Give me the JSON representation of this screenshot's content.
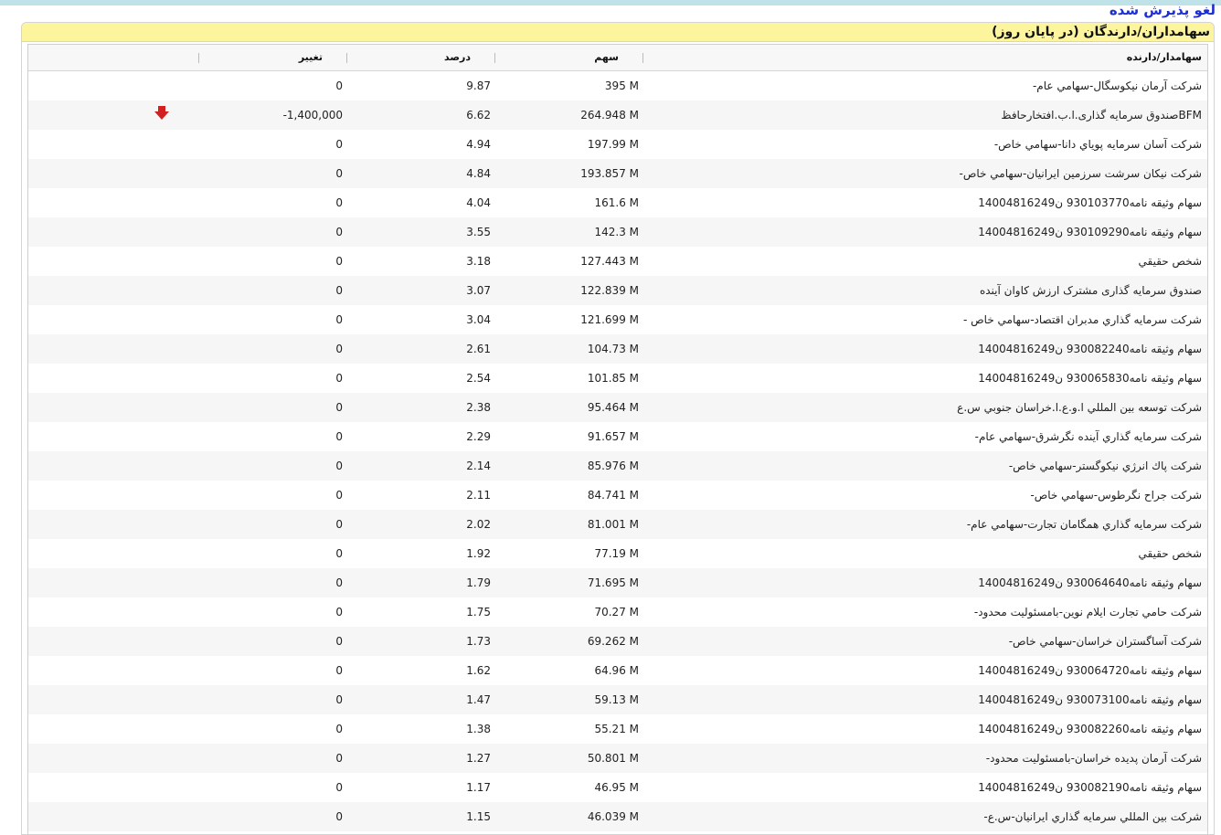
{
  "top_link": "لغو پذیرش شده",
  "panel_title": "سهامداران/دارندگان (در پایان روز)",
  "colors": {
    "title_bg": "#fdf59d",
    "link": "#1d2fd3",
    "down_arrow": "#d21f1f"
  },
  "columns": {
    "holder": "سهامدار/دارنده",
    "shares": "سهم",
    "percent": "درصد",
    "change": "تغییر"
  },
  "rows": [
    {
      "holder": "شرکت آرمان نیکوسگال-سهامي عام-",
      "shares": "395 M",
      "percent": "9.87",
      "change": "0",
      "indicator": ""
    },
    {
      "holder": "BFMصندوق سرمایه گذاری.ا.ب.افتخارحافظ",
      "shares": "264.948 M",
      "percent": "6.62",
      "change": "-1,400,000",
      "indicator": "down-arrow-icon"
    },
    {
      "holder": "شرکت آسان سرمایه پویاي دانا-سهامي خاص-",
      "shares": "197.99 M",
      "percent": "4.94",
      "change": "0",
      "indicator": ""
    },
    {
      "holder": "شرکت نیکان سرشت سرزمین ایرانیان-سهامي خاص-",
      "shares": "193.857 M",
      "percent": "4.84",
      "change": "0",
      "indicator": ""
    },
    {
      "holder": "سهام وثیقه نامه930103770 ن14004816249",
      "shares": "161.6 M",
      "percent": "4.04",
      "change": "0",
      "indicator": ""
    },
    {
      "holder": "سهام وثیقه نامه930109290 ن14004816249",
      "shares": "142.3 M",
      "percent": "3.55",
      "change": "0",
      "indicator": ""
    },
    {
      "holder": "شخص حقیقي",
      "shares": "127.443 M",
      "percent": "3.18",
      "change": "0",
      "indicator": ""
    },
    {
      "holder": "صندوق سرمایه گذاری مشترک ارزش کاوان آینده",
      "shares": "122.839 M",
      "percent": "3.07",
      "change": "0",
      "indicator": ""
    },
    {
      "holder": "شرکت سرمایه گذاري مدبران اقتصاد-سهامي خاص -",
      "shares": "121.699 M",
      "percent": "3.04",
      "change": "0",
      "indicator": ""
    },
    {
      "holder": "سهام وثیقه نامه930082240 ن14004816249",
      "shares": "104.73 M",
      "percent": "2.61",
      "change": "0",
      "indicator": ""
    },
    {
      "holder": "سهام وثیقه نامه930065830 ن14004816249",
      "shares": "101.85 M",
      "percent": "2.54",
      "change": "0",
      "indicator": ""
    },
    {
      "holder": "شرکت توسعه بین المللي ا.و.ع.ا.خراسان جنوبي س.ع",
      "shares": "95.464 M",
      "percent": "2.38",
      "change": "0",
      "indicator": ""
    },
    {
      "holder": "شرکت سرمایه گذاري آینده نگرشرق-سهامي عام-",
      "shares": "91.657 M",
      "percent": "2.29",
      "change": "0",
      "indicator": ""
    },
    {
      "holder": "شرکت پاك انرژي نیکوگستر-سهامي خاص-",
      "shares": "85.976 M",
      "percent": "2.14",
      "change": "0",
      "indicator": ""
    },
    {
      "holder": "شرکت جراح نگرطوس-سهامي خاص-",
      "shares": "84.741 M",
      "percent": "2.11",
      "change": "0",
      "indicator": ""
    },
    {
      "holder": "شرکت سرمایه گذاري همگامان تجارت-سهامي عام-",
      "shares": "81.001 M",
      "percent": "2.02",
      "change": "0",
      "indicator": ""
    },
    {
      "holder": "شخص حقیقي",
      "shares": "77.19 M",
      "percent": "1.92",
      "change": "0",
      "indicator": ""
    },
    {
      "holder": "سهام وثیقه نامه930064640 ن14004816249",
      "shares": "71.695 M",
      "percent": "1.79",
      "change": "0",
      "indicator": ""
    },
    {
      "holder": "شرکت حامي تجارت ایلام نوین-بامسئولیت محدود-",
      "shares": "70.27 M",
      "percent": "1.75",
      "change": "0",
      "indicator": ""
    },
    {
      "holder": "شرکت آساگستران خراسان-سهامي خاص-",
      "shares": "69.262 M",
      "percent": "1.73",
      "change": "0",
      "indicator": ""
    },
    {
      "holder": "سهام وثیقه نامه930064720 ن14004816249",
      "shares": "64.96 M",
      "percent": "1.62",
      "change": "0",
      "indicator": ""
    },
    {
      "holder": "سهام وثیقه نامه930073100 ن14004816249",
      "shares": "59.13 M",
      "percent": "1.47",
      "change": "0",
      "indicator": ""
    },
    {
      "holder": "سهام وثیقه نامه930082260 ن14004816249",
      "shares": "55.21 M",
      "percent": "1.38",
      "change": "0",
      "indicator": ""
    },
    {
      "holder": "شرکت آرمان پدیده خراسان-بامسئولیت محدود-",
      "shares": "50.801 M",
      "percent": "1.27",
      "change": "0",
      "indicator": ""
    },
    {
      "holder": "سهام وثیقه نامه930082190 ن14004816249",
      "shares": "46.95 M",
      "percent": "1.17",
      "change": "0",
      "indicator": ""
    },
    {
      "holder": "شرکت بین المللي سرمایه گذاري ایرانیان-س.ع-",
      "shares": "46.039 M",
      "percent": "1.15",
      "change": "0",
      "indicator": ""
    }
  ]
}
